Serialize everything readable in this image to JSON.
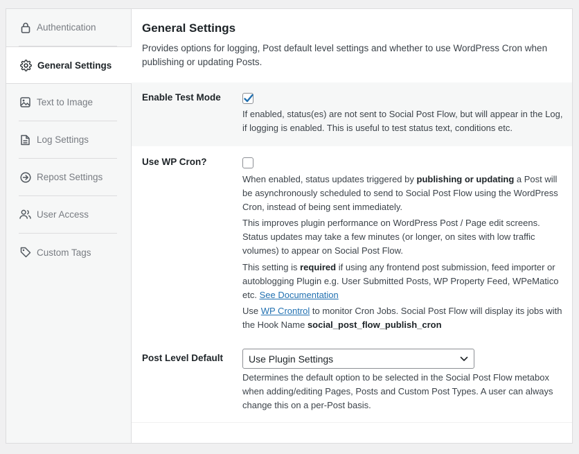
{
  "sidebar": {
    "items": [
      {
        "label": "Authentication",
        "icon": "lock-icon"
      },
      {
        "label": "General Settings",
        "icon": "gear-icon",
        "active": true
      },
      {
        "label": "Text to Image",
        "icon": "image-icon"
      },
      {
        "label": "Log Settings",
        "icon": "document-icon"
      },
      {
        "label": "Repost Settings",
        "icon": "arrow-circle-icon"
      },
      {
        "label": "User Access",
        "icon": "users-icon"
      },
      {
        "label": "Custom Tags",
        "icon": "tag-icon"
      }
    ]
  },
  "main": {
    "title": "General Settings",
    "description": "Provides options for logging, Post default level settings and whether to use WordPress Cron when publishing or updating Posts.",
    "test_mode": {
      "label": "Enable Test Mode",
      "checked": true,
      "help": "If enabled, status(es) are not sent to Social Post Flow, but will appear in the Log, if logging is enabled. This is useful to test status text, conditions etc."
    },
    "wp_cron": {
      "label": "Use WP Cron?",
      "checked": false,
      "help1_a": "When enabled, status updates triggered by ",
      "help1_b": "publishing or updating",
      "help1_c": " a Post will be asynchronously scheduled to send to Social Post Flow using the WordPress Cron, instead of being sent immediately.",
      "help2": "This improves plugin performance on WordPress Post / Page edit screens. Status updates may take a few minutes (or longer, on sites with low traffic volumes) to appear on Social Post Flow.",
      "help3_a": "This setting is ",
      "help3_b": "required",
      "help3_c": " if using any frontend post submission, feed importer or autoblogging Plugin e.g. User Submitted Posts, WP Property Feed, WPeMatico etc. ",
      "help3_link": "See Documentation",
      "help4_a": "Use ",
      "help4_link": "WP Crontrol",
      "help4_b": " to monitor Cron Jobs. Social Post Flow will display its jobs with the Hook Name ",
      "help4_hook": "social_post_flow_publish_cron"
    },
    "post_level": {
      "label": "Post Level Default",
      "selected": "Use Plugin Settings",
      "help": "Determines the default option to be selected in the Social Post Flow metabox when adding/editing Pages, Posts and Custom Post Types. A user can always change this on a per-Post basis."
    }
  },
  "colors": {
    "accent": "#2271b1",
    "text": "#1d2327",
    "muted": "#787c82",
    "shade": "#f6f7f7"
  }
}
